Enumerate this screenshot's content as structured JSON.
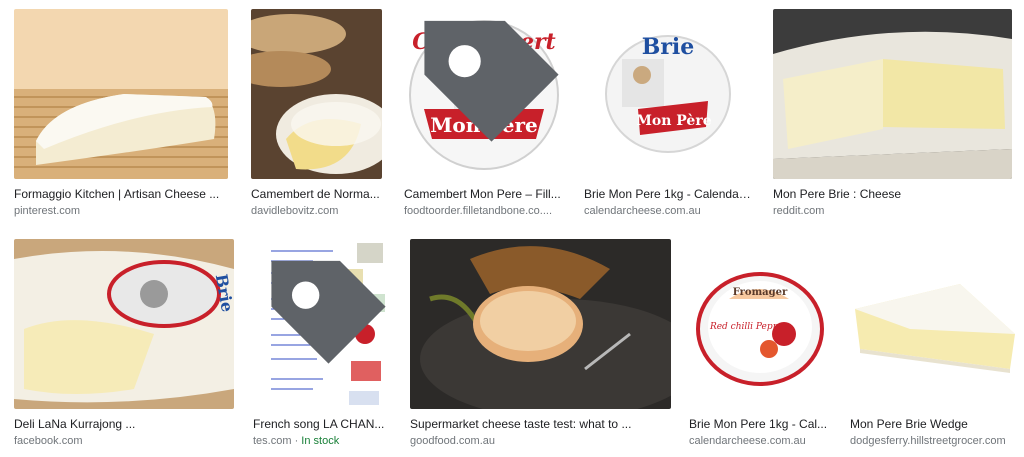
{
  "results": [
    {
      "title": "Formaggio Kitchen | Artisan Cheese ...",
      "source": "pinterest.com",
      "image_icon": "brie-wedge-on-mat-image"
    },
    {
      "title": "Camembert de Norma...",
      "source": "davidlebovitz.com",
      "image_icon": "camembert-with-bread-image"
    },
    {
      "title": "Camembert Mon Pere – Fill...",
      "source": "foodtoorder.filletandbone.co....",
      "image_icon": "camembert-label-image",
      "logo": {
        "line1": "Camembert",
        "line2": "Mon Père"
      }
    },
    {
      "title": "Brie Mon Pere 1kg - Calendar ...",
      "source": "calendarcheese.com.au",
      "image_icon": "brie-label-image",
      "logo": {
        "line1": "Brie",
        "line2": "Mon Père"
      }
    },
    {
      "title": "Mon Pere Brie : Cheese",
      "source": "reddit.com",
      "image_icon": "brie-cut-open-image"
    },
    {
      "title": "Deli LaNa Kurrajong ...",
      "source": "facebook.com",
      "image_icon": "brie-wheel-image",
      "logo": {
        "line1": "Brie"
      }
    },
    {
      "title": "French song LA CHAN...",
      "source": "tes.com",
      "source_separator": " · ",
      "stock": "In stock",
      "image_icon": "worksheet-image"
    },
    {
      "title": "Supermarket cheese taste test: what to ...",
      "source": "goodfood.com.au",
      "image_icon": "cheese-on-plate-image"
    },
    {
      "title": "Brie Mon Pere 1kg - Cal...",
      "source": "calendarcheese.com.au",
      "image_icon": "fromager-pepper-image",
      "logo": {
        "line1": "Fromager",
        "line2": "Red chilli Pepper"
      }
    },
    {
      "title": "Mon Pere Brie Wedge",
      "source": "dodgesferry.hillstreetgrocer.com",
      "image_icon": "brie-wedge-image"
    }
  ],
  "colors": {
    "title": "#202124",
    "source": "#70757a",
    "stock": "#188038",
    "label_red": "#c8202a",
    "label_blue": "#1f4fa0"
  }
}
